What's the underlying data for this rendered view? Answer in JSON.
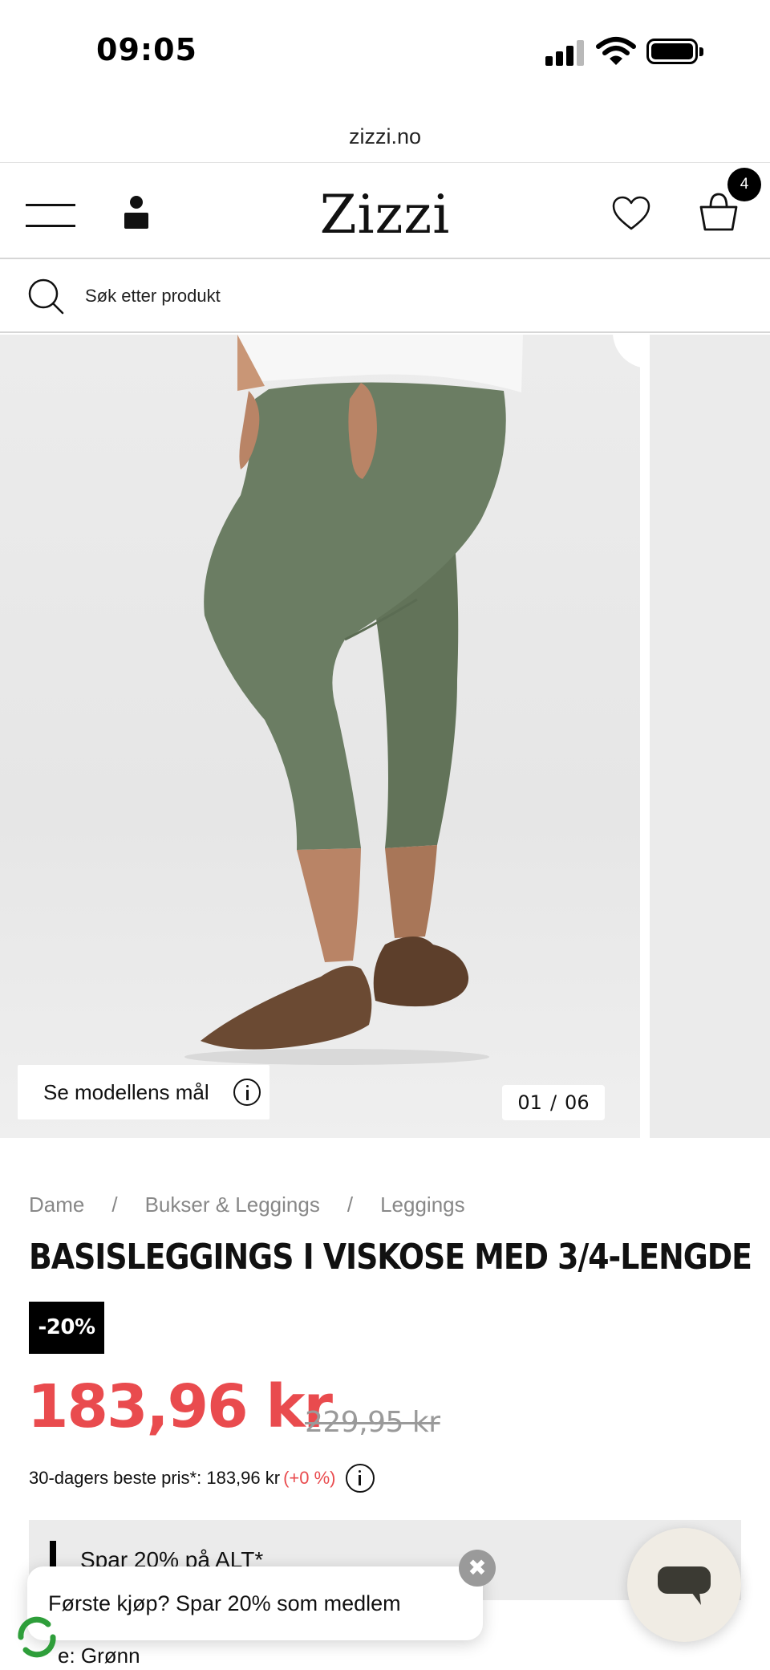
{
  "status_bar": {
    "time": "09:05"
  },
  "browser": {
    "url": "zizzi.no"
  },
  "header": {
    "logo": "Zizzi",
    "cart_count": "4"
  },
  "search": {
    "placeholder": "Søk etter produkt"
  },
  "gallery": {
    "model_button_label": "Se modellens mål",
    "current_image": "01",
    "separator": "/",
    "total_images": "06"
  },
  "breadcrumb": {
    "items": [
      "Dame",
      "Bukser & Leggings",
      "Leggings"
    ],
    "separator": "/"
  },
  "product": {
    "title": "BASISLEGGINGS I VISKOSE MED 3/4-LENGDE",
    "discount_badge": "-20%",
    "price": "183,96 kr",
    "old_price": "229,95 kr",
    "best_price_label": "30-dagers beste pris*: 183,96 kr",
    "best_price_change": "(+0 %)",
    "color_line": "e: Grønn"
  },
  "promo": {
    "text": "Spar 20% på ALT*"
  },
  "toast": {
    "text": "Første kjøp? Spar 20% som medlem",
    "close_symbol": "✖"
  },
  "colors": {
    "price_red": "#e94b4e",
    "leggings_green": "#6b7d63",
    "badge_black": "#000000",
    "promo_background": "#ebebeb"
  },
  "icons": [
    "hamburger-menu-icon",
    "account-icon",
    "heart-icon",
    "shopping-bag-icon",
    "search-icon",
    "info-icon",
    "close-icon",
    "chat-icon"
  ]
}
